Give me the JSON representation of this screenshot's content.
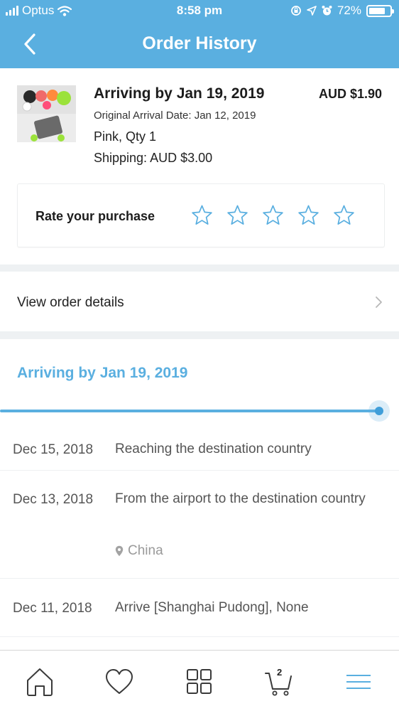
{
  "status_bar": {
    "carrier": "Optus",
    "time": "8:58 pm",
    "battery": "72%"
  },
  "header": {
    "title": "Order History",
    "back_icon": "chevron-left-icon"
  },
  "product": {
    "arrival": "Arriving by Jan 19, 2019",
    "price": "AUD $1.90",
    "original_arrival": "Original Arrival Date: Jan 12, 2019",
    "variant": "Pink, Qty 1",
    "shipping": "Shipping: AUD $3.00"
  },
  "rating": {
    "label": "Rate your purchase",
    "stars": 5,
    "selected": 0
  },
  "view_details": {
    "label": "View order details"
  },
  "tracking": {
    "title": "Arriving by Jan 19, 2019",
    "progress": 1.0,
    "events": [
      {
        "date": "Dec 15, 2018",
        "description": "Reaching the destination country",
        "location": ""
      },
      {
        "date": "Dec 13, 2018",
        "description": "From the airport to the destination country",
        "location": "China"
      },
      {
        "date": "Dec 11, 2018",
        "description": "Arrive [Shanghai Pudong], None",
        "location": ""
      }
    ]
  },
  "tabbar": {
    "cart_count": "2",
    "icons": [
      "home-icon",
      "heart-icon",
      "grid-icon",
      "cart-icon",
      "menu-icon"
    ]
  },
  "colors": {
    "accent": "#5aafe0",
    "separator": "#eef1f3"
  }
}
